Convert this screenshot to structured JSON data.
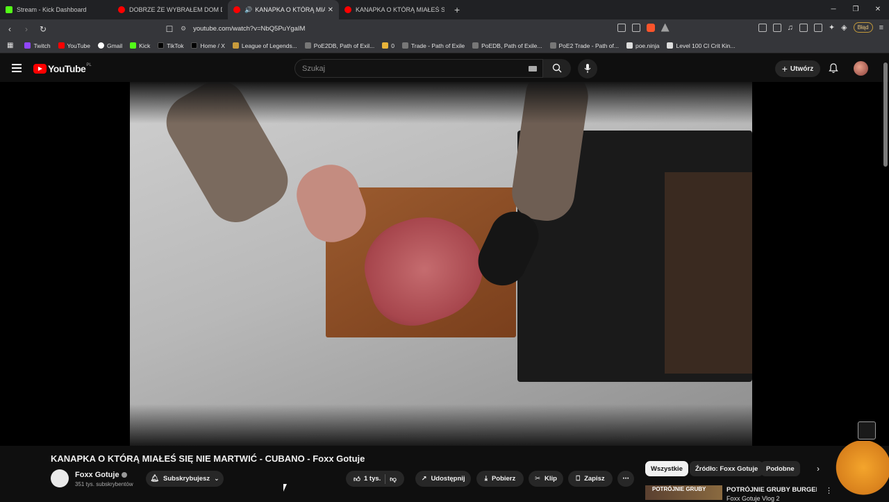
{
  "browser": {
    "tabs": [
      {
        "title": "Stream - Kick Dashboard",
        "favicon_color": "#53fc18",
        "active": false
      },
      {
        "title": "DOBRZE ŻE WYBRAŁEM DOM DREW",
        "favicon_color": "#ff0000",
        "active": false
      },
      {
        "title": "KANAPKA O KTÓRĄ MIAŁEŚ",
        "favicon_color": "#ff0000",
        "active": true
      },
      {
        "title": "KANAPKA O KTÓRĄ MIAŁEŚ SIĘ NIE",
        "favicon_color": "#ff0000",
        "active": false
      }
    ],
    "new_tab_label": "+",
    "url": "youtube.com/watch?v=NbQ5PuYgaIM",
    "profile_label": "Błąd",
    "bookmarks": [
      {
        "label": "Twitch",
        "color": "#9146ff"
      },
      {
        "label": "YouTube",
        "color": "#ff0000"
      },
      {
        "label": "Gmail",
        "color": "#ea4335"
      },
      {
        "label": "Kick",
        "color": "#53fc18"
      },
      {
        "label": "TikTok",
        "color": "#111111"
      },
      {
        "label": "Home / X",
        "color": "#111111"
      },
      {
        "label": "League of Legends...",
        "color": "#c89b3c"
      },
      {
        "label": "PoE2DB, Path of Exil...",
        "color": "#777777"
      },
      {
        "label": "0",
        "color": "#e8b43a"
      },
      {
        "label": "Trade - Path of Exile",
        "color": "#777777"
      },
      {
        "label": "PoEDB, Path of Exile...",
        "color": "#777777"
      },
      {
        "label": "PoE2 Trade - Path of...",
        "color": "#777777"
      },
      {
        "label": "poe.ninja",
        "color": "#dddddd"
      },
      {
        "label": "Level 100 CI Crit Kin...",
        "color": "#dddddd"
      }
    ]
  },
  "youtube": {
    "logo_text": "YouTube",
    "logo_country": "PL",
    "search_placeholder": "Szukaj",
    "create_label": "Utwórz",
    "video": {
      "title": "KANAPKA O KTÓRĄ MIAŁEŚ SIĘ NIE MARTWIĆ - CUBANO - Foxx Gotuje",
      "channel_name": "Foxx Gotuje",
      "subscribers": "351 tys. subskrybentów",
      "subscribe_label": "Subskrybujesz",
      "likes": "1 tys.",
      "share_label": "Udostępnij",
      "download_label": "Pobierz",
      "clip_label": "Klip",
      "save_label": "Zapisz"
    },
    "filters": [
      "Wszystkie",
      "Źródło: Foxx Gotuje",
      "Podobne"
    ],
    "recommendation": {
      "thumb_text": "POTRÓJNIE GRUBY",
      "title": "POTRÓJNIE GRUBY BURGER -",
      "subtitle": "Foxx Gotuje Vlog 2"
    }
  },
  "colors": {
    "accent_red": "#ff0000",
    "background": "#0f0f0f",
    "pill": "#272727"
  }
}
